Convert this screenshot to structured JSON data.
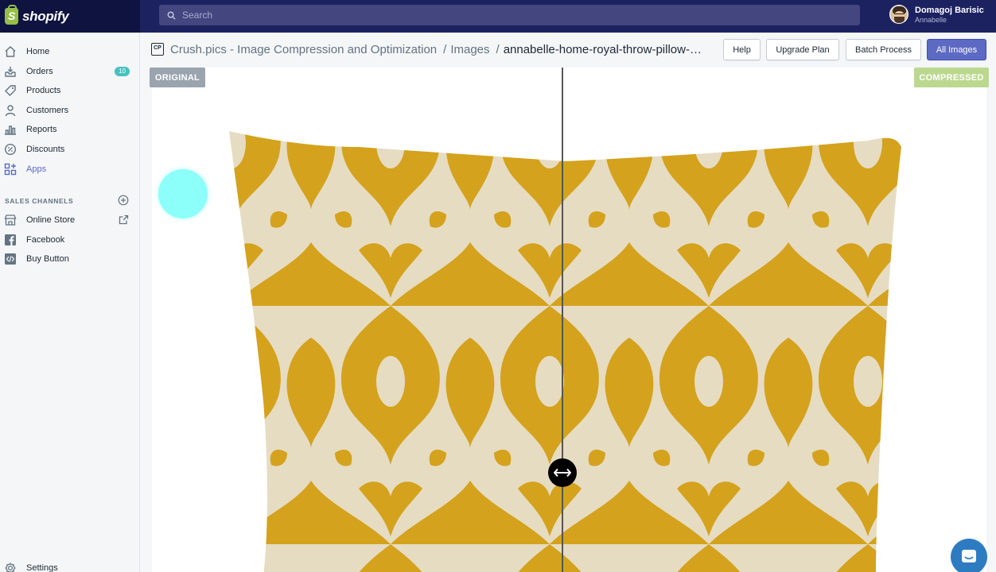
{
  "topbar": {
    "brand": "shopify",
    "search_placeholder": "Search",
    "user_name": "Domagoj Barisic",
    "store_name": "Annabelle"
  },
  "sidebar": {
    "items": [
      {
        "label": "Home",
        "icon": "home-icon"
      },
      {
        "label": "Orders",
        "icon": "orders-icon",
        "badge": "10"
      },
      {
        "label": "Products",
        "icon": "tag-icon"
      },
      {
        "label": "Customers",
        "icon": "person-icon"
      },
      {
        "label": "Reports",
        "icon": "bar-chart-icon"
      },
      {
        "label": "Discounts",
        "icon": "discount-icon"
      },
      {
        "label": "Apps",
        "icon": "apps-icon",
        "active": true
      }
    ],
    "channels_heading": "SALES CHANNELS",
    "channels": [
      {
        "label": "Online Store",
        "icon": "store-icon"
      },
      {
        "label": "Facebook",
        "icon": "facebook-icon"
      },
      {
        "label": "Buy Button",
        "icon": "code-icon"
      }
    ],
    "settings_label": "Settings"
  },
  "breadcrumb": {
    "app_icon_text": "CP",
    "app": "Crush.pics - Image Compression and Optimization",
    "section": "Images",
    "current": "annabelle-home-royal-throw-pillow-yellow"
  },
  "actions": {
    "help": "Help",
    "upgrade": "Upgrade Plan",
    "batch": "Batch Process",
    "all_images": "All Images"
  },
  "viewer": {
    "original_label": "ORIGINAL",
    "compressed_label": "COMPRESSED",
    "slider_position_percent": 49
  },
  "colors": {
    "topbar": "#1c2260",
    "accent": "#5c6ac4",
    "pillow_yellow": "#d4a21c",
    "pillow_cream": "#e8dfc6",
    "badge": "#47c1bf"
  }
}
